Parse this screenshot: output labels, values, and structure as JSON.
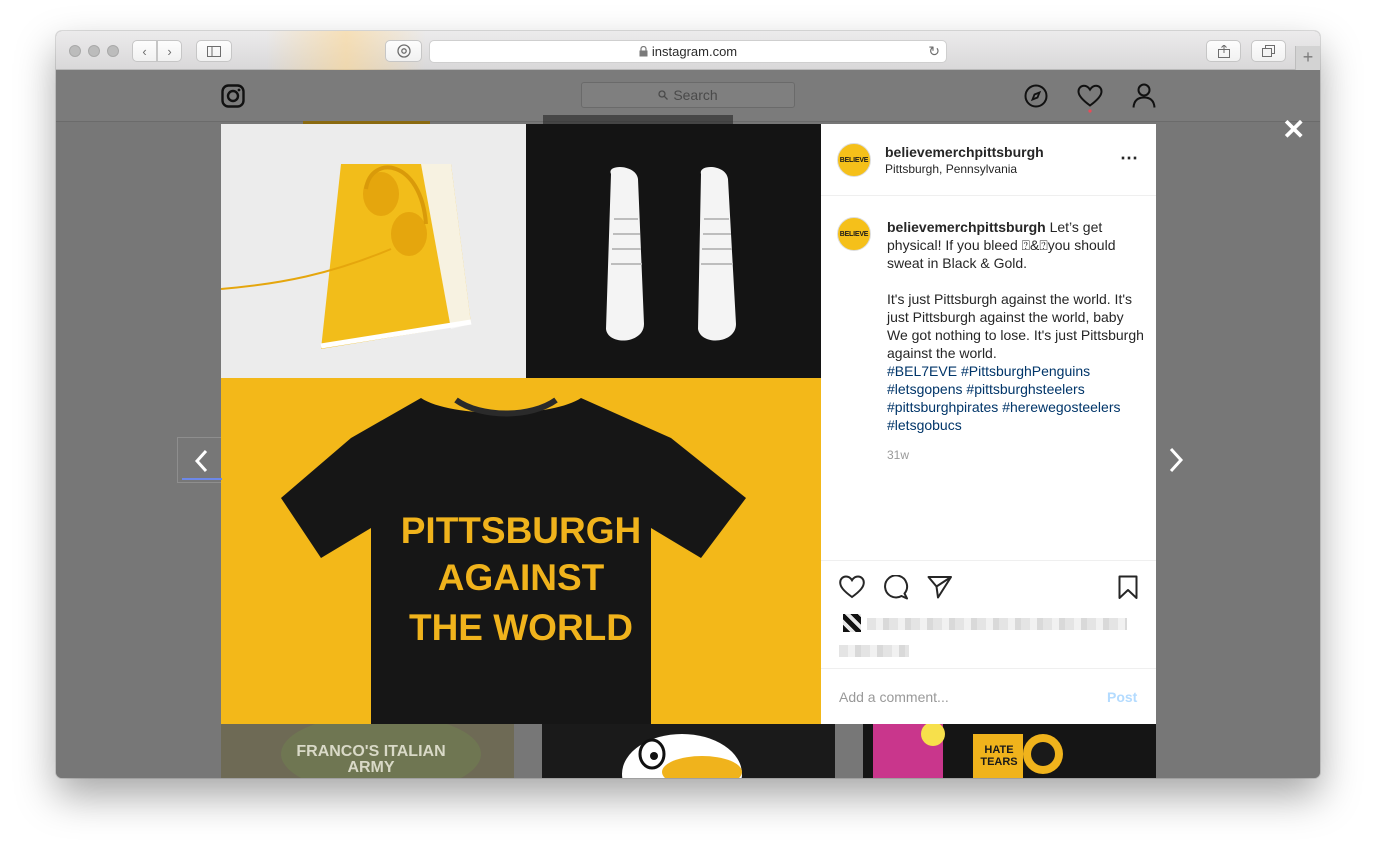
{
  "browser": {
    "url": "instagram.com"
  },
  "instagram": {
    "search_placeholder": "Search"
  },
  "post": {
    "username": "believemerchpittsburgh",
    "location": "Pittsburgh, Pennsylvania",
    "avatar_text": "BELIEVE",
    "caption_lead": "Let’s get physical! If you bleed ⍰&⍰you should sweat in Black & Gold.",
    "caption_body": "It's just Pittsburgh against the world. It's just Pittsburgh against the world, baby We got nothing to lose. It's just Pittsburgh against the world.",
    "hashtags": [
      "#BEL7EVE",
      "#PittsburghPenguins",
      "#letsgopens",
      "#pittsburghsteelers",
      "#pittsburghpirates",
      "#herewegosteelers",
      "#letsgobucs"
    ],
    "age": "31w",
    "comment_placeholder": "Add a comment...",
    "post_label": "Post",
    "shirt_lines": [
      "PITTSBURGH",
      "AGAINST",
      "THE WORLD"
    ]
  },
  "grid": {
    "tile1_text": "FRANCO'S ITALIAN ARMY",
    "tile3_text": "HATE TEARS"
  },
  "colors": {
    "accent_yellow": "#f3b819",
    "link_blue": "#003569",
    "post_disabled": "#b3dbff"
  }
}
